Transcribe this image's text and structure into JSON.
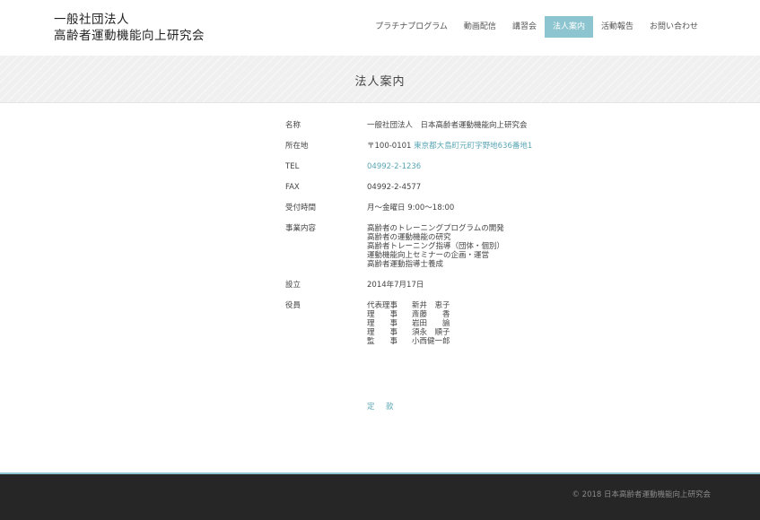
{
  "header": {
    "logo_line1": "一般社団法人",
    "logo_line2": "高齢者運動機能向上研究会",
    "nav": [
      {
        "label": "プラチナプログラム",
        "active": false
      },
      {
        "label": "動画配信",
        "active": false
      },
      {
        "label": "講習会",
        "active": false
      },
      {
        "label": "法人案内",
        "active": true
      },
      {
        "label": "活動報告",
        "active": false
      },
      {
        "label": "お問い合わせ",
        "active": false
      }
    ]
  },
  "page_title": "法人案内",
  "info": {
    "name": {
      "label": "名称",
      "value": "一般社団法人　日本高齢者運動機能向上研究会"
    },
    "address": {
      "label": "所在地",
      "postal": "〒100-0101",
      "link": "東京都大島町元町字野地636番地1"
    },
    "tel": {
      "label": "TEL",
      "value": "04992-2-1236"
    },
    "fax": {
      "label": "FAX",
      "value": "04992-2-4577"
    },
    "hours": {
      "label": "受付時間",
      "value": "月〜金曜日  9:00〜18:00"
    },
    "business": {
      "label": "事業内容",
      "lines": [
        "高齢者のトレーニングプログラムの開発",
        "高齢者の運動機能の研究",
        "高齢者トレーニング指導（団体・個別）",
        "運動機能向上セミナーの企画・運営",
        "高齢者運動指導士養成"
      ]
    },
    "established": {
      "label": "設立",
      "value": "2014年7月17日"
    },
    "officers": {
      "label": "役員",
      "list": [
        {
          "title": "代表理事",
          "name": "新井　恵子"
        },
        {
          "title": "理　　事",
          "name": "斎藤　　香"
        },
        {
          "title": "理　　事",
          "name": "岩田　　諭"
        },
        {
          "title": "理　　事",
          "name": "須永　順子"
        },
        {
          "title": "監　　事",
          "name": "小西健一郎"
        }
      ]
    }
  },
  "teikan_link": "定　款",
  "footer": {
    "copyright": "©  2018  日本高齢者運動機能向上研究会"
  },
  "colors": {
    "accent": "#8cc4cf",
    "link": "#5aa6b4",
    "footer_bg": "#262626"
  }
}
